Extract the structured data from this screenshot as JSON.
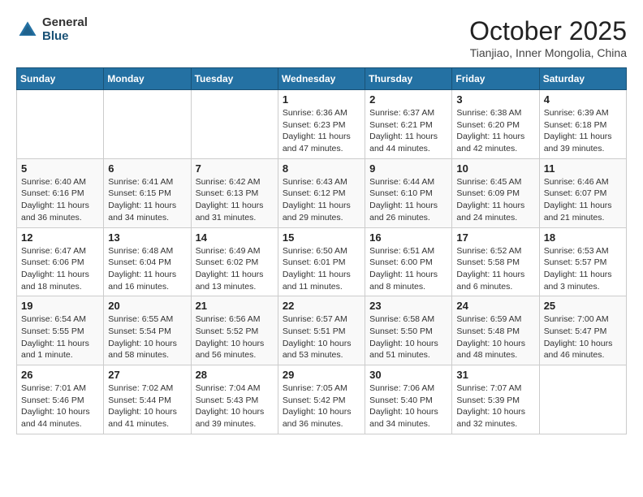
{
  "header": {
    "logo": {
      "general": "General",
      "blue": "Blue"
    },
    "title": "October 2025",
    "subtitle": "Tianjiao, Inner Mongolia, China"
  },
  "weekdays": [
    "Sunday",
    "Monday",
    "Tuesday",
    "Wednesday",
    "Thursday",
    "Friday",
    "Saturday"
  ],
  "weeks": [
    [
      {
        "day": null
      },
      {
        "day": null
      },
      {
        "day": null
      },
      {
        "day": 1,
        "sunrise": "Sunrise: 6:36 AM",
        "sunset": "Sunset: 6:23 PM",
        "daylight": "Daylight: 11 hours and 47 minutes."
      },
      {
        "day": 2,
        "sunrise": "Sunrise: 6:37 AM",
        "sunset": "Sunset: 6:21 PM",
        "daylight": "Daylight: 11 hours and 44 minutes."
      },
      {
        "day": 3,
        "sunrise": "Sunrise: 6:38 AM",
        "sunset": "Sunset: 6:20 PM",
        "daylight": "Daylight: 11 hours and 42 minutes."
      },
      {
        "day": 4,
        "sunrise": "Sunrise: 6:39 AM",
        "sunset": "Sunset: 6:18 PM",
        "daylight": "Daylight: 11 hours and 39 minutes."
      }
    ],
    [
      {
        "day": 5,
        "sunrise": "Sunrise: 6:40 AM",
        "sunset": "Sunset: 6:16 PM",
        "daylight": "Daylight: 11 hours and 36 minutes."
      },
      {
        "day": 6,
        "sunrise": "Sunrise: 6:41 AM",
        "sunset": "Sunset: 6:15 PM",
        "daylight": "Daylight: 11 hours and 34 minutes."
      },
      {
        "day": 7,
        "sunrise": "Sunrise: 6:42 AM",
        "sunset": "Sunset: 6:13 PM",
        "daylight": "Daylight: 11 hours and 31 minutes."
      },
      {
        "day": 8,
        "sunrise": "Sunrise: 6:43 AM",
        "sunset": "Sunset: 6:12 PM",
        "daylight": "Daylight: 11 hours and 29 minutes."
      },
      {
        "day": 9,
        "sunrise": "Sunrise: 6:44 AM",
        "sunset": "Sunset: 6:10 PM",
        "daylight": "Daylight: 11 hours and 26 minutes."
      },
      {
        "day": 10,
        "sunrise": "Sunrise: 6:45 AM",
        "sunset": "Sunset: 6:09 PM",
        "daylight": "Daylight: 11 hours and 24 minutes."
      },
      {
        "day": 11,
        "sunrise": "Sunrise: 6:46 AM",
        "sunset": "Sunset: 6:07 PM",
        "daylight": "Daylight: 11 hours and 21 minutes."
      }
    ],
    [
      {
        "day": 12,
        "sunrise": "Sunrise: 6:47 AM",
        "sunset": "Sunset: 6:06 PM",
        "daylight": "Daylight: 11 hours and 18 minutes."
      },
      {
        "day": 13,
        "sunrise": "Sunrise: 6:48 AM",
        "sunset": "Sunset: 6:04 PM",
        "daylight": "Daylight: 11 hours and 16 minutes."
      },
      {
        "day": 14,
        "sunrise": "Sunrise: 6:49 AM",
        "sunset": "Sunset: 6:02 PM",
        "daylight": "Daylight: 11 hours and 13 minutes."
      },
      {
        "day": 15,
        "sunrise": "Sunrise: 6:50 AM",
        "sunset": "Sunset: 6:01 PM",
        "daylight": "Daylight: 11 hours and 11 minutes."
      },
      {
        "day": 16,
        "sunrise": "Sunrise: 6:51 AM",
        "sunset": "Sunset: 6:00 PM",
        "daylight": "Daylight: 11 hours and 8 minutes."
      },
      {
        "day": 17,
        "sunrise": "Sunrise: 6:52 AM",
        "sunset": "Sunset: 5:58 PM",
        "daylight": "Daylight: 11 hours and 6 minutes."
      },
      {
        "day": 18,
        "sunrise": "Sunrise: 6:53 AM",
        "sunset": "Sunset: 5:57 PM",
        "daylight": "Daylight: 11 hours and 3 minutes."
      }
    ],
    [
      {
        "day": 19,
        "sunrise": "Sunrise: 6:54 AM",
        "sunset": "Sunset: 5:55 PM",
        "daylight": "Daylight: 11 hours and 1 minute."
      },
      {
        "day": 20,
        "sunrise": "Sunrise: 6:55 AM",
        "sunset": "Sunset: 5:54 PM",
        "daylight": "Daylight: 10 hours and 58 minutes."
      },
      {
        "day": 21,
        "sunrise": "Sunrise: 6:56 AM",
        "sunset": "Sunset: 5:52 PM",
        "daylight": "Daylight: 10 hours and 56 minutes."
      },
      {
        "day": 22,
        "sunrise": "Sunrise: 6:57 AM",
        "sunset": "Sunset: 5:51 PM",
        "daylight": "Daylight: 10 hours and 53 minutes."
      },
      {
        "day": 23,
        "sunrise": "Sunrise: 6:58 AM",
        "sunset": "Sunset: 5:50 PM",
        "daylight": "Daylight: 10 hours and 51 minutes."
      },
      {
        "day": 24,
        "sunrise": "Sunrise: 6:59 AM",
        "sunset": "Sunset: 5:48 PM",
        "daylight": "Daylight: 10 hours and 48 minutes."
      },
      {
        "day": 25,
        "sunrise": "Sunrise: 7:00 AM",
        "sunset": "Sunset: 5:47 PM",
        "daylight": "Daylight: 10 hours and 46 minutes."
      }
    ],
    [
      {
        "day": 26,
        "sunrise": "Sunrise: 7:01 AM",
        "sunset": "Sunset: 5:46 PM",
        "daylight": "Daylight: 10 hours and 44 minutes."
      },
      {
        "day": 27,
        "sunrise": "Sunrise: 7:02 AM",
        "sunset": "Sunset: 5:44 PM",
        "daylight": "Daylight: 10 hours and 41 minutes."
      },
      {
        "day": 28,
        "sunrise": "Sunrise: 7:04 AM",
        "sunset": "Sunset: 5:43 PM",
        "daylight": "Daylight: 10 hours and 39 minutes."
      },
      {
        "day": 29,
        "sunrise": "Sunrise: 7:05 AM",
        "sunset": "Sunset: 5:42 PM",
        "daylight": "Daylight: 10 hours and 36 minutes."
      },
      {
        "day": 30,
        "sunrise": "Sunrise: 7:06 AM",
        "sunset": "Sunset: 5:40 PM",
        "daylight": "Daylight: 10 hours and 34 minutes."
      },
      {
        "day": 31,
        "sunrise": "Sunrise: 7:07 AM",
        "sunset": "Sunset: 5:39 PM",
        "daylight": "Daylight: 10 hours and 32 minutes."
      },
      {
        "day": null
      }
    ]
  ]
}
